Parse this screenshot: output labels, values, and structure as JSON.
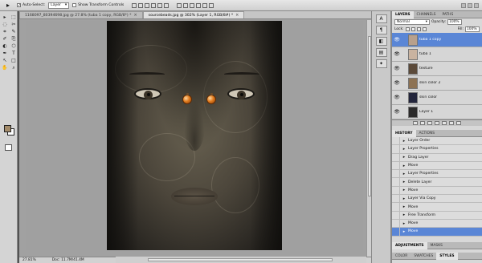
{
  "options_bar": {
    "auto_select_label": "Auto-Select:",
    "auto_select_checked": true,
    "auto_select_value": "Layer",
    "show_transform_label": "Show Transform Controls",
    "show_transform_checked": false
  },
  "tools": [
    "▸",
    "⬚",
    "◌",
    "✂",
    "⌗",
    "✎",
    "✐",
    "⎘",
    "◐",
    "⬡",
    "✒",
    "T",
    "↖",
    "□",
    "✋",
    "⌕"
  ],
  "colors": {
    "foreground": "#a38b6a",
    "background": "#ffffff",
    "selection": "#5a86d6"
  },
  "document": {
    "tabs": [
      {
        "label": "1168097_80394698.jpg @ 27.8% (tuba 1 copy, RGB/8*) *",
        "active": false
      },
      {
        "label": "sourcebeads.jpg @ 302% (Layer 1, RGB/8#) *",
        "active": true
      }
    ],
    "close_glyph": "×",
    "status_zoom": "27.81%",
    "status_doc": "Doc: 11.7M/41.4M"
  },
  "collapsed_panel_icons": [
    "A",
    "¶",
    "◧",
    "▤",
    "✦"
  ],
  "layers_panel": {
    "tabs": [
      "LAYERS",
      "CHANNELS",
      "PATHS"
    ],
    "active_tab": "LAYERS",
    "blend_mode": "Normal",
    "opacity_label": "Opacity:",
    "opacity_value": "100%",
    "lock_label": "Lock:",
    "fill_label": "Fill:",
    "fill_value": "100%",
    "layers": [
      {
        "name": "tuba 1 copy",
        "selected": true,
        "thumb": "#b8a08c"
      },
      {
        "name": "tuba 1",
        "selected": false,
        "thumb": "#c9b3a0"
      },
      {
        "name": "texture",
        "selected": false,
        "thumb": "#5b4a3a"
      },
      {
        "name": "skin color 2",
        "selected": false,
        "thumb": "#8d7253"
      },
      {
        "name": "skin color",
        "selected": false,
        "thumb": "#23253c"
      },
      {
        "name": "Layer 1",
        "selected": false,
        "thumb": "#2b2a2a"
      }
    ]
  },
  "history_panel": {
    "tabs": [
      "HISTORY",
      "ACTIONS"
    ],
    "active_tab": "HISTORY",
    "items": [
      "Layer Order",
      "Layer Properties",
      "Drag Layer",
      "Move",
      "Layer Properties",
      "Delete Layer",
      "Move",
      "Layer Via Copy",
      "Move",
      "Free Transform",
      "Move",
      "Move"
    ],
    "selected_index": 11
  },
  "adjustments_panel": {
    "tabs": [
      "ADJUSTMENTS",
      "MASKS"
    ]
  },
  "color_panel": {
    "tabs": [
      "COLOR",
      "SWATCHES",
      "STYLES"
    ]
  }
}
